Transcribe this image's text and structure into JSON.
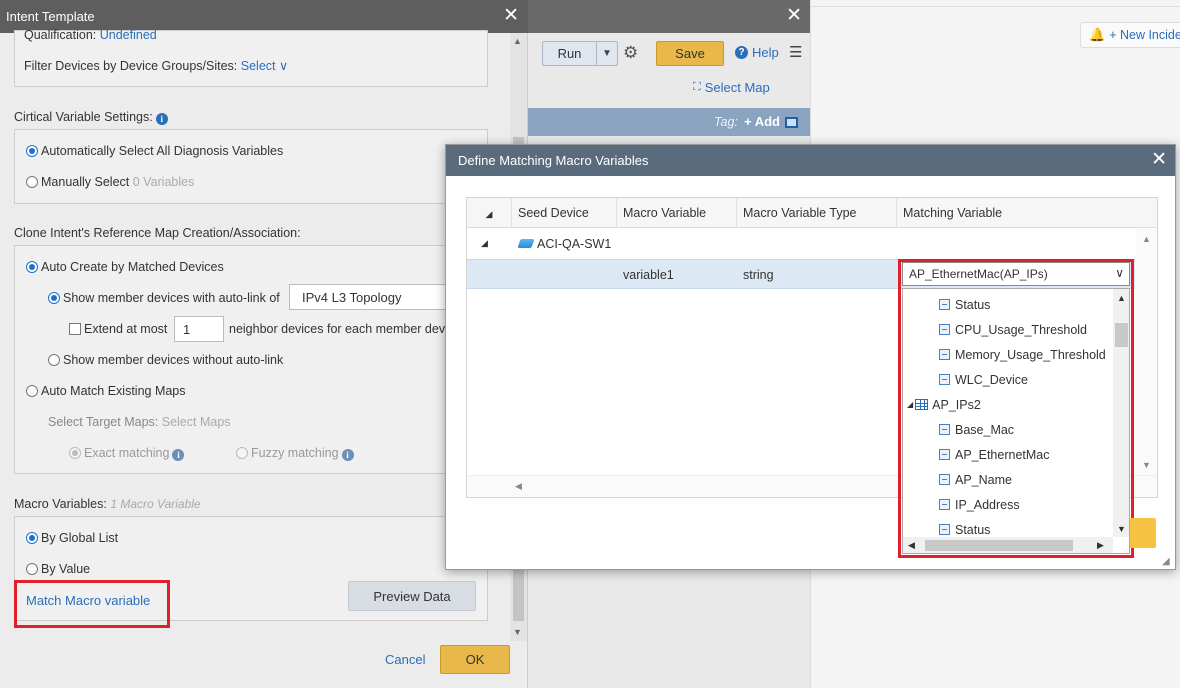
{
  "background": {
    "new_incident": "+ New Incide"
  },
  "mid_panel": {
    "run_label": "Run",
    "save_label": "Save",
    "help_label": "Help",
    "select_map_label": "Select Map",
    "tag_label": "Tag:",
    "add_label": "+ Add"
  },
  "intent_template": {
    "title": "Intent Template",
    "qualification_label": "Qualification:",
    "qualification_value": "Undefined",
    "filter_label": "Filter Devices by Device Groups/Sites:",
    "filter_value": "Select",
    "critical_settings_label": "Cirtical Variable Settings:",
    "auto_select_label": "Automatically Select All Diagnosis Variables",
    "manual_select_label": "Manually Select",
    "manual_select_count": "0 Variables",
    "clone_label": "Clone Intent's Reference Map Creation/Association:",
    "auto_create_label": "Auto Create by Matched Devices",
    "show_autolink_label": "Show member devices with auto-link of",
    "topology_value": "IPv4 L3 Topology",
    "extend_label": "Extend at most",
    "extend_value": "1",
    "neighbor_label": "neighbor devices for each member dev",
    "show_without_label": "Show member devices without auto-link",
    "auto_match_label": "Auto Match Existing Maps",
    "select_target_label": "Select Target Maps:",
    "select_target_value": "Select Maps",
    "exact_label": "Exact matching",
    "fuzzy_label": "Fuzzy matching",
    "macro_label": "Macro Variables:",
    "macro_count": "1 Macro Variable",
    "by_global_label": "By Global List",
    "by_value_label": "By Value",
    "match_macro_label": "Match Macro variable",
    "preview_label": "Preview Data",
    "cancel_label": "Cancel",
    "ok_label": "OK"
  },
  "modal": {
    "title": "Define Matching Macro Variables",
    "columns": [
      "Seed Device",
      "Macro Variable",
      "Macro Variable Type",
      "Matching Variable"
    ],
    "group_device": "ACI-QA-SW1",
    "row": {
      "macro_variable": "variable1",
      "type": "string",
      "matching_variable": "AP_EthernetMac(AP_IPs)"
    },
    "dropdown_items": [
      {
        "label": "Status",
        "kind": "var",
        "indent": 1
      },
      {
        "label": "CPU_Usage_Threshold",
        "kind": "var",
        "indent": 1
      },
      {
        "label": "Memory_Usage_Threshold",
        "kind": "var",
        "indent": 1
      },
      {
        "label": "WLC_Device",
        "kind": "var",
        "indent": 1
      },
      {
        "label": "AP_IPs2",
        "kind": "table",
        "indent": 0
      },
      {
        "label": "Base_Mac",
        "kind": "var",
        "indent": 1
      },
      {
        "label": "AP_EthernetMac",
        "kind": "var",
        "indent": 1
      },
      {
        "label": "AP_Name",
        "kind": "var",
        "indent": 1
      },
      {
        "label": "IP_Address",
        "kind": "var",
        "indent": 1
      },
      {
        "label": "Status",
        "kind": "var",
        "indent": 1
      }
    ]
  },
  "colors": {
    "accent_blue": "#2a6ebb",
    "save_gold": "#e8b84a",
    "highlight_red": "#e0202a",
    "modal_header": "#5a6b7d",
    "row_selected": "#dce9f5"
  }
}
